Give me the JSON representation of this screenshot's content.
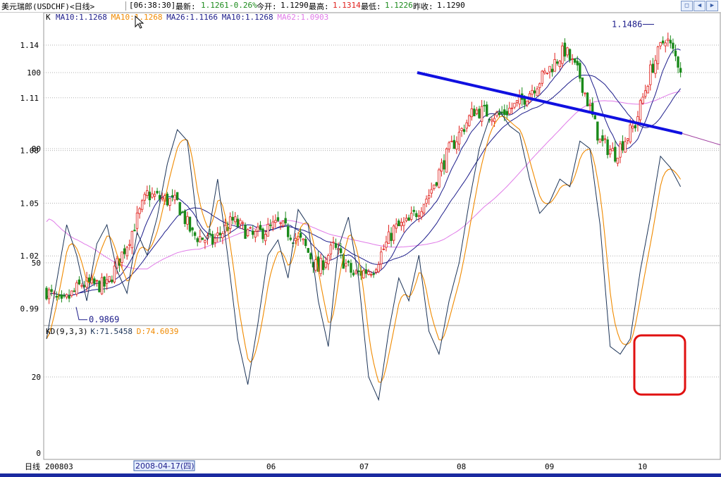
{
  "header": {
    "symbol": "美元瑞郎(USDCHF)<日线>",
    "time": "[06:38:30]",
    "latest_label": "最新:",
    "latest_value": "1.1261",
    "change": "-0.26%",
    "open_label": "今开:",
    "open_value": "1.1290",
    "high_label": "最高:",
    "high_value": "1.1314",
    "low_label": "最低:",
    "low_value": "1.1226",
    "prev_close_label": "昨收:",
    "prev_close_value": "1.1290",
    "window_buttons": [
      "restore-icon",
      "back-icon",
      "forward-icon"
    ]
  },
  "colors": {
    "up": "#e0201c",
    "down": "#1a8a1a",
    "ma10": "#1c1c8a",
    "ma26": "#1c1c8a",
    "ma62": "#e07ae8",
    "k_line": "#1c3458",
    "d_line": "#f08a00",
    "trendline": "#1010e0",
    "highlight_box": "#e01010",
    "grid": "#b0b0b0"
  },
  "chart_data": [
    {
      "type": "candlestick",
      "legend": {
        "prefix": "K",
        "items": [
          {
            "label": "MA10:1.1268",
            "color": "#1c1c8a"
          },
          {
            "label": "MA10:1.1268",
            "color": "#f08a00"
          },
          {
            "label": "MA26:1.1166",
            "color": "#1c1c8a"
          },
          {
            "label": "MA10:1.1268",
            "color": "#1c1c8a"
          },
          {
            "label": "MA62:1.0903",
            "color": "#e07ae8"
          }
        ]
      },
      "y_ticks": [
        "1.14",
        "1.11",
        "1.08",
        "1.05",
        "1.02",
        "0.99"
      ],
      "ylim": [
        0.988,
        1.149
      ],
      "annotations": [
        {
          "text": "1.1486",
          "value": 1.1486
        },
        {
          "text": "0.9869",
          "value": 0.9869
        }
      ],
      "ma_values_at_end": {
        "MA10": 1.1268,
        "MA26": 1.1166,
        "MA62": 1.0903
      }
    },
    {
      "type": "line",
      "legend": {
        "prefix": "KD(9,3,3)",
        "items": [
          {
            "label": "K:71.5458",
            "color": "#1c3458"
          },
          {
            "label": "D:74.6039",
            "color": "#f08a00"
          }
        ]
      },
      "y_ticks": [
        "100",
        "80",
        "50",
        "20",
        "0"
      ],
      "ylim": [
        0,
        100
      ],
      "series": [
        {
          "name": "K",
          "value_at_end": 71.5458
        },
        {
          "name": "D",
          "value_at_end": 74.6039
        }
      ]
    }
  ],
  "x_axis": {
    "period_label": "日线",
    "labels": [
      "200803",
      "06",
      "07",
      "08",
      "09",
      "10"
    ],
    "cursor_date": "2008-04-17(四)"
  }
}
